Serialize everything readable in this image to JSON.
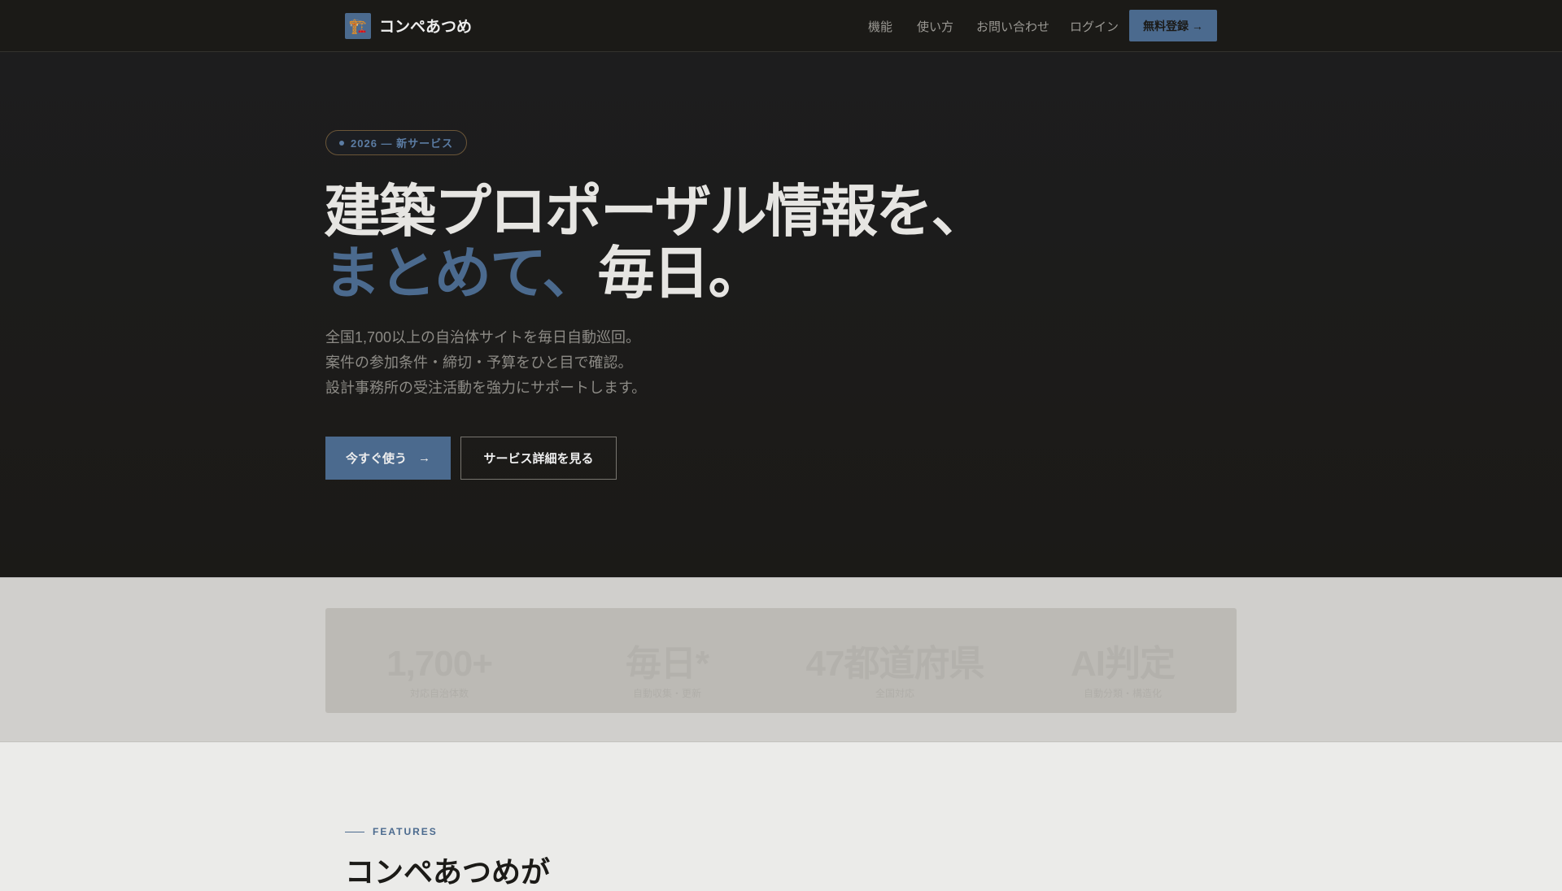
{
  "nav": {
    "brand": "コンペあつめ",
    "logo_icon": "🏗️",
    "links": [
      "機能",
      "使い方",
      "お問い合わせ",
      "ログイン"
    ],
    "cta": "無料登録 →"
  },
  "hero": {
    "badge": "2026 — 新サービス",
    "title_line1": "建築プロポーザル情報を、",
    "title_accent": "まとめて、",
    "title_rest": "毎日。",
    "desc": [
      "全国1,700以上の自治体サイトを毎日自動巡回。",
      "案件の参加条件・締切・予算をひと目で確認。",
      "設計事務所の受注活動を強力にサポートします。"
    ],
    "primary_button": "今すぐ使う",
    "primary_arrow": "→",
    "secondary_button": "サービス詳細を見る"
  },
  "stats": [
    {
      "value": "1,700+",
      "label": "対応自治体数"
    },
    {
      "value": "毎日*",
      "label": "自動収集・更新"
    },
    {
      "value": "47都道府県",
      "label": "全国対応"
    },
    {
      "value": "AI判定",
      "label": "自動分類・構造化"
    }
  ],
  "features": {
    "eyebrow": "FEATURES",
    "heading": "コンペあつめが"
  },
  "colors": {
    "accent": "#4b6a8e",
    "dark": "#1b1a17"
  }
}
